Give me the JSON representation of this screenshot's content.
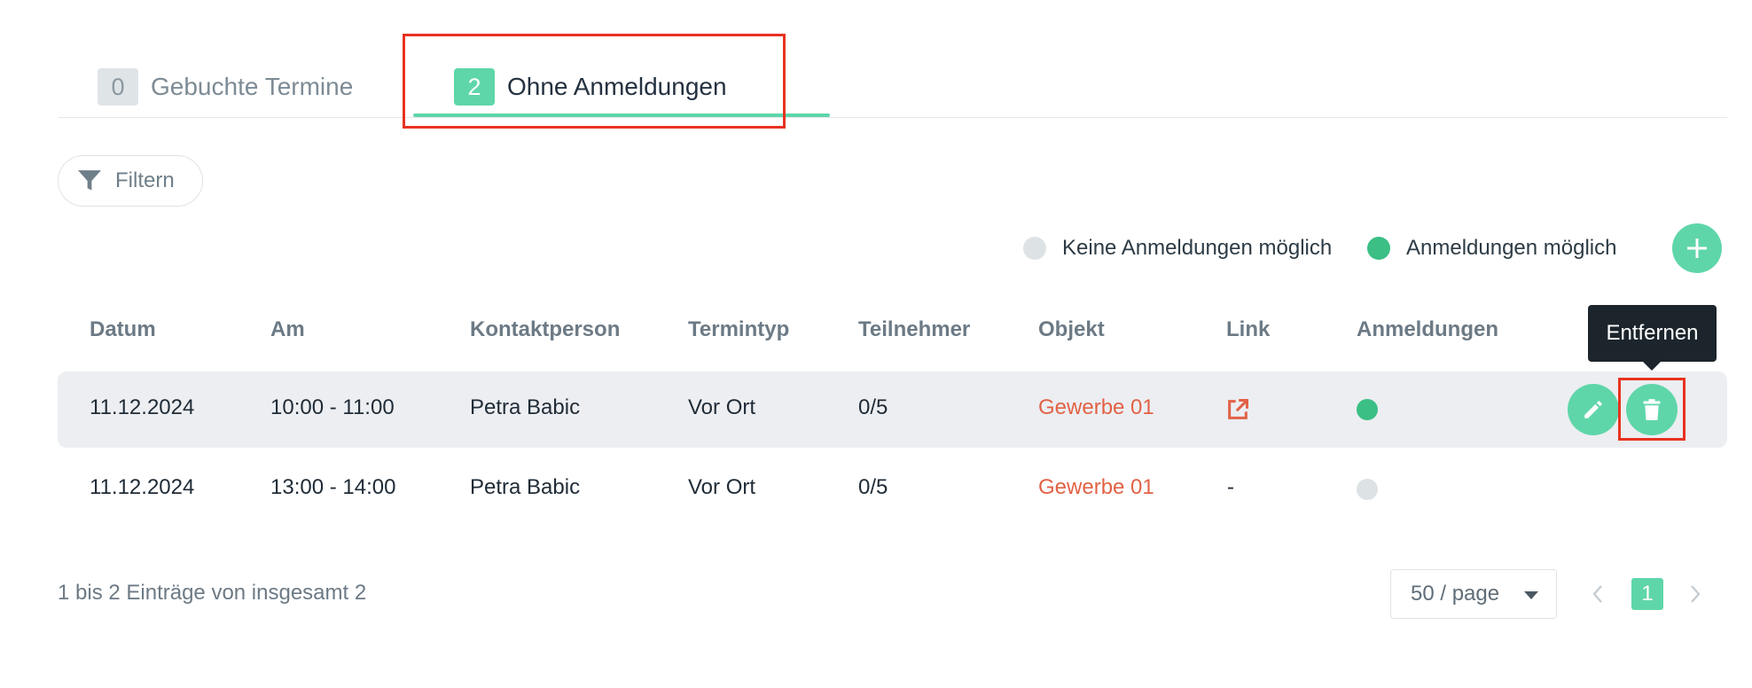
{
  "tabs": [
    {
      "count": "0",
      "label": "Gebuchte Termine",
      "active": false
    },
    {
      "count": "2",
      "label": "Ohne Anmeldungen",
      "active": true
    }
  ],
  "filter": {
    "label": "Filtern"
  },
  "legend": {
    "none": {
      "label": "Keine Anmeldungen möglich",
      "color": "#dde2e5"
    },
    "possible": {
      "label": "Anmeldungen möglich",
      "color": "#3bbf85"
    }
  },
  "table": {
    "headers": [
      "Datum",
      "Am",
      "Kontaktperson",
      "Termintyp",
      "Teilnehmer",
      "Objekt",
      "Link",
      "Anmeldungen"
    ],
    "rows": [
      {
        "datum": "11.12.2024",
        "am": "10:00 - 11:00",
        "kontaktperson": "Petra Babic",
        "termintyp": "Vor Ort",
        "teilnehmer": "0/5",
        "objekt": "Gewerbe 01",
        "link": "external-link-icon",
        "anmeldungen": "possible"
      },
      {
        "datum": "11.12.2024",
        "am": "13:00 - 14:00",
        "kontaktperson": "Petra Babic",
        "termintyp": "Vor Ort",
        "teilnehmer": "0/5",
        "objekt": "Gewerbe 01",
        "link": "-",
        "anmeldungen": "none"
      }
    ]
  },
  "tooltip": {
    "text": "Entfernen"
  },
  "footer": {
    "summary": "1 bis 2 Einträge von insgesamt 2",
    "page_size": "50 / page",
    "current_page": "1"
  },
  "colors": {
    "accent": "#5fd6a9",
    "highlight": "#e8321f",
    "link": "#e26246"
  }
}
